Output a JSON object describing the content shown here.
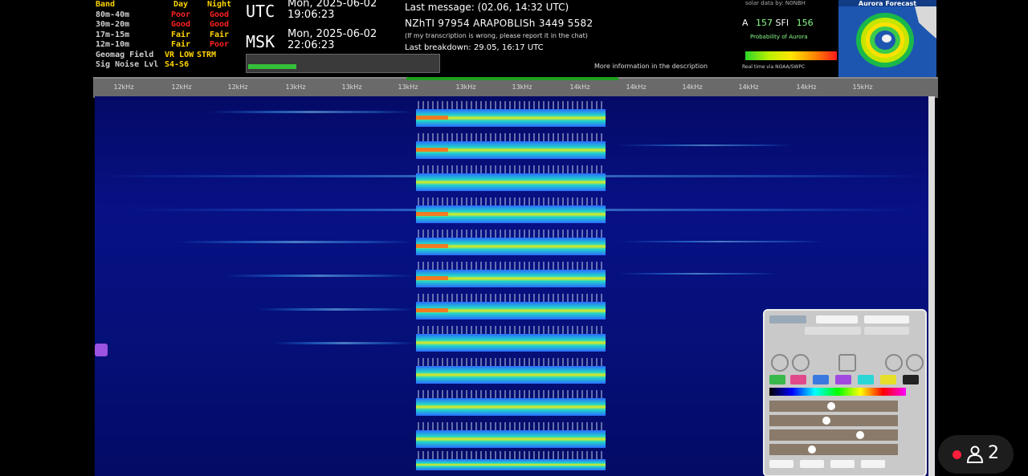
{
  "band_conditions": {
    "headers": [
      "Band",
      "Day",
      "Night"
    ],
    "rows": [
      {
        "band": "80m-40m",
        "day": "Poor",
        "night": "Good"
      },
      {
        "band": "30m-20m",
        "day": "Good",
        "night": "Good"
      },
      {
        "band": "17m-15m",
        "day": "Fair",
        "night": "Fair"
      },
      {
        "band": "12m-10m",
        "day": "Fair",
        "night": "Poor"
      }
    ],
    "geomag_label": "Geomag Field",
    "geomag_value": "VR LOW",
    "geomag_value2": "STRM",
    "noise_label": "Sig Noise Lvl",
    "noise_value": "S4-S6"
  },
  "clocks": [
    {
      "zone": "UTC",
      "date": "Mon, 2025-06-02",
      "time": "19:06:23"
    },
    {
      "zone": "MSK",
      "date": "Mon, 2025-06-02",
      "time": "22:06:23"
    }
  ],
  "messages": {
    "last_message": "Last message: (02.06, 14:32 UTC)",
    "transcription": "NZhTI 97954 ARAPOBLISh 3449 5582",
    "disclaimer": "(If my transcription is wrong, please report it in the chat)",
    "last_breakdown": "Last breakdown: 29.05, 16:17 UTC",
    "more_info": "More information in the description"
  },
  "solar": {
    "header": "solar data by: N0NBH",
    "a_label": "A",
    "sfi_value": "157",
    "sfi_label": "SFI",
    "ssn_value": "156",
    "caption": "Probability of Aurora",
    "footnote": "Real time via NOAA/SWPC"
  },
  "aurora": {
    "title": "Aurora Forecast"
  },
  "ruler_ticks": [
    "12kHz",
    "12kHz",
    "12kHz",
    "13kHz",
    "13kHz",
    "13kHz",
    "13kHz",
    "13kHz",
    "14kHz",
    "14kHz",
    "14kHz",
    "14kHz",
    "14kHz",
    "15kHz"
  ],
  "viewers": {
    "count": "2"
  },
  "colors": {
    "poor": "#ff2020",
    "fair": "#ffd400",
    "good": "#30ff30",
    "waterfall_bg": "#071185",
    "signal_core": "#e8e81a",
    "live": "#ff1f3a"
  },
  "icons": [
    "user-icon",
    "zoom-in-icon",
    "zoom-out-icon",
    "pen-icon",
    "settings-icon"
  ]
}
